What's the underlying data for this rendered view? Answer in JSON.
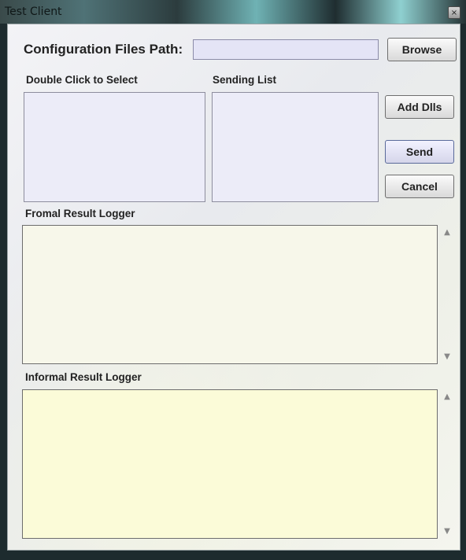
{
  "window": {
    "title": "Test Client",
    "close_glyph": "×"
  },
  "config": {
    "label": "Configuration Files Path:",
    "path_value": "",
    "browse_label": "Browse"
  },
  "lists": {
    "select_label": "Double Click to Select",
    "sending_label": "Sending List"
  },
  "buttons": {
    "add_dlls": "Add Dlls",
    "send": "Send",
    "cancel": "Cancel"
  },
  "formal_logger": {
    "label": "Fromal Result Logger",
    "content": ""
  },
  "informal_logger": {
    "label": "Informal Result Logger",
    "content": ""
  },
  "colors": {
    "formal_bg": "#f7f7ea",
    "informal_bg": "#fbfbd8",
    "list_bg": "#ececf8",
    "input_bg": "#e4e4f6"
  },
  "icons": {
    "scroll_up": "▲",
    "scroll_down": "▼"
  }
}
